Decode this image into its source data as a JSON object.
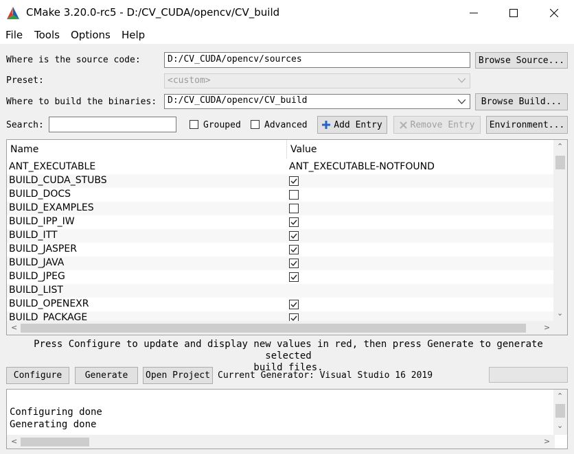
{
  "window": {
    "title": "CMake 3.20.0-rc5 - D:/CV_CUDA/opencv/CV_build",
    "logo_colors": [
      "#e8312d",
      "#1f5fb3",
      "#2ea043",
      "#9a9a9a"
    ]
  },
  "menu": [
    "File",
    "Tools",
    "Options",
    "Help"
  ],
  "source": {
    "label": "Where is the source code:",
    "value": "D:/CV_CUDA/opencv/sources",
    "button": "Browse Source..."
  },
  "preset": {
    "label": "Preset:",
    "value": "<custom>"
  },
  "build": {
    "label": "Where to build the binaries:",
    "value": "D:/CV_CUDA/opencv/CV_build",
    "button": "Browse Build..."
  },
  "search": {
    "label": "Search:",
    "value": "",
    "grouped": "Grouped",
    "grouped_checked": false,
    "advanced": "Advanced",
    "advanced_checked": false,
    "add_entry": "Add Entry",
    "remove_entry": "Remove Entry",
    "environment": "Environment..."
  },
  "table": {
    "col_name": "Name",
    "col_value": "Value",
    "rows": [
      {
        "name": "ANT_EXECUTABLE",
        "kind": "text",
        "value": "ANT_EXECUTABLE-NOTFOUND"
      },
      {
        "name": "BUILD_CUDA_STUBS",
        "kind": "bool",
        "checked": true
      },
      {
        "name": "BUILD_DOCS",
        "kind": "bool",
        "checked": false
      },
      {
        "name": "BUILD_EXAMPLES",
        "kind": "bool",
        "checked": false
      },
      {
        "name": "BUILD_IPP_IW",
        "kind": "bool",
        "checked": true
      },
      {
        "name": "BUILD_ITT",
        "kind": "bool",
        "checked": true
      },
      {
        "name": "BUILD_JASPER",
        "kind": "bool",
        "checked": true
      },
      {
        "name": "BUILD_JAVA",
        "kind": "bool",
        "checked": true
      },
      {
        "name": "BUILD_JPEG",
        "kind": "bool",
        "checked": true
      },
      {
        "name": "BUILD_LIST",
        "kind": "text",
        "value": ""
      },
      {
        "name": "BUILD_OPENEXR",
        "kind": "bool",
        "checked": true
      },
      {
        "name": "BUILD_PACKAGE",
        "kind": "bool",
        "checked": true
      }
    ]
  },
  "hint": {
    "line1": "Press Configure to update and display new values in red, then press Generate to generate selected",
    "line2": "build files."
  },
  "actions": {
    "configure": "Configure",
    "generate": "Generate",
    "open_project": "Open Project",
    "generator": "Current Generator: Visual Studio 16 2019"
  },
  "output": {
    "lines": [
      "",
      "Configuring done",
      "Generating done"
    ]
  }
}
